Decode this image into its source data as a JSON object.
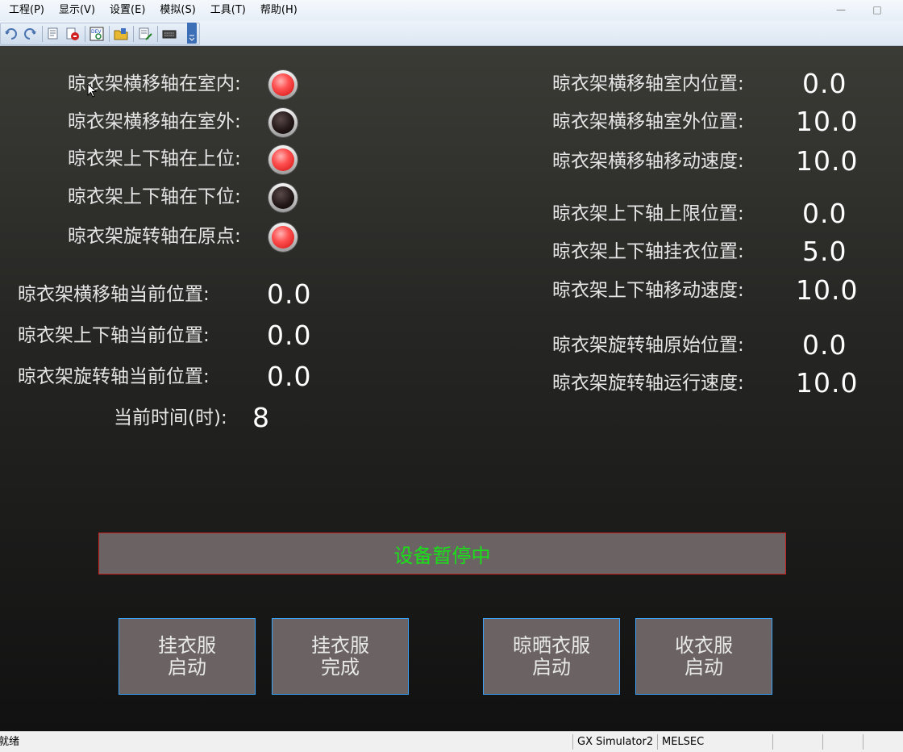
{
  "menu": [
    "工程(P)",
    "显示(V)",
    "设置(E)",
    "模拟(S)",
    "工具(T)",
    "帮助(H)"
  ],
  "window_controls": {
    "minimize": "—",
    "maximize": "□"
  },
  "toolbar_icons": [
    "undo-icon",
    "redo-icon",
    "monitor-icon",
    "stop-icon",
    "device-search-icon",
    "open-folder-icon",
    "write-icon",
    "keyboard-icon"
  ],
  "indicators": [
    {
      "label": "晾衣架横移轴在室内:",
      "on": true
    },
    {
      "label": "晾衣架横移轴在室外:",
      "on": false
    },
    {
      "label": "晾衣架上下轴在上位:",
      "on": true
    },
    {
      "label": "晾衣架上下轴在下位:",
      "on": false
    },
    {
      "label": "晾衣架旋转轴在原点:",
      "on": true
    }
  ],
  "current_values": [
    {
      "label": "晾衣架横移轴当前位置:",
      "value": "0.0"
    },
    {
      "label": "晾衣架上下轴当前位置:",
      "value": "0.0"
    },
    {
      "label": "晾衣架旋转轴当前位置:",
      "value": "0.0"
    }
  ],
  "time": {
    "label": "当前时间(时):",
    "value": "8"
  },
  "params": [
    {
      "label": "晾衣架横移轴室内位置:",
      "value": "0.0"
    },
    {
      "label": "晾衣架横移轴室外位置:",
      "value": "10.0"
    },
    {
      "label": "晾衣架横移轴移动速度:",
      "value": "10.0"
    },
    {
      "label": "晾衣架上下轴上限位置:",
      "value": "0.0"
    },
    {
      "label": "晾衣架上下轴挂衣位置:",
      "value": "5.0"
    },
    {
      "label": "晾衣架上下轴移动速度:",
      "value": "10.0"
    },
    {
      "label": "晾衣架旋转轴原始位置:",
      "value": "0.0"
    },
    {
      "label": "晾衣架旋转轴运行速度:",
      "value": "10.0"
    }
  ],
  "status_message": "设备暂停中",
  "buttons": [
    {
      "line1": "挂衣服",
      "line2": "启动"
    },
    {
      "line1": "挂衣服",
      "line2": "完成"
    },
    {
      "line1": "晾晒衣服",
      "line2": "启动"
    },
    {
      "line1": "收衣服",
      "line2": "启动"
    }
  ],
  "statusbar": {
    "ready": "就绪",
    "app": "GX Simulator2",
    "vendor": "MELSEC"
  },
  "colors": {
    "status_text": "#19e019",
    "lamp_on": "#ff4040",
    "lamp_off": "#1a1010",
    "button_border": "#3aa4ff",
    "status_border": "#c42020"
  }
}
